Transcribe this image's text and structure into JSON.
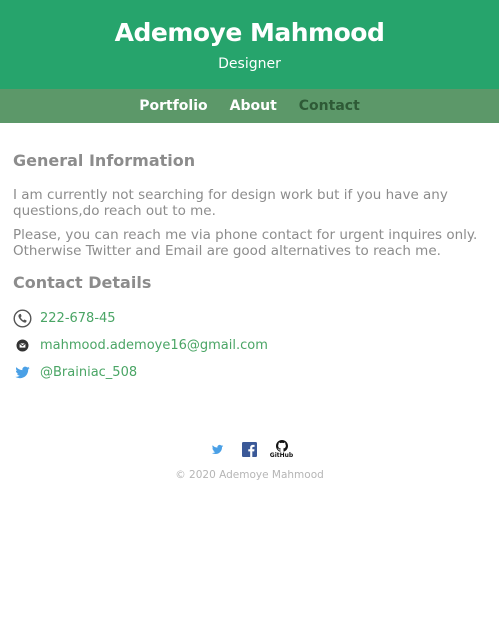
{
  "header": {
    "title": "Ademoye Mahmood",
    "subtitle": "Designer"
  },
  "nav": {
    "items": [
      {
        "label": "Portfolio"
      },
      {
        "label": "About"
      },
      {
        "label": "Contact",
        "active": true
      }
    ]
  },
  "general": {
    "heading": "General Information",
    "paragraphs": [
      "I am currently not searching for design work but if you have any questions,do reach out to me.",
      "Please, you can reach me via phone contact for urgent inquires only. Otherwise Twitter and Email are good alternatives to reach me."
    ]
  },
  "contact": {
    "heading": "Contact Details",
    "phone": "222-678-45",
    "email": "mahmood.ademoye16@gmail.com",
    "twitter": "@Brainiac_508"
  },
  "footer": {
    "github_label": "GitHub",
    "copyright": "© 2020 Ademoye Mahmood"
  },
  "colors": {
    "header": "#26a46c",
    "nav": "#5c9869",
    "nav_active": "#2e5a36",
    "link": "#4aa565",
    "text": "#8c8c8c",
    "twitter": "#4aa0e6",
    "facebook": "#3b5998"
  },
  "icons": [
    "phone-icon",
    "email-icon",
    "twitter-icon",
    "facebook-icon",
    "github-icon"
  ]
}
